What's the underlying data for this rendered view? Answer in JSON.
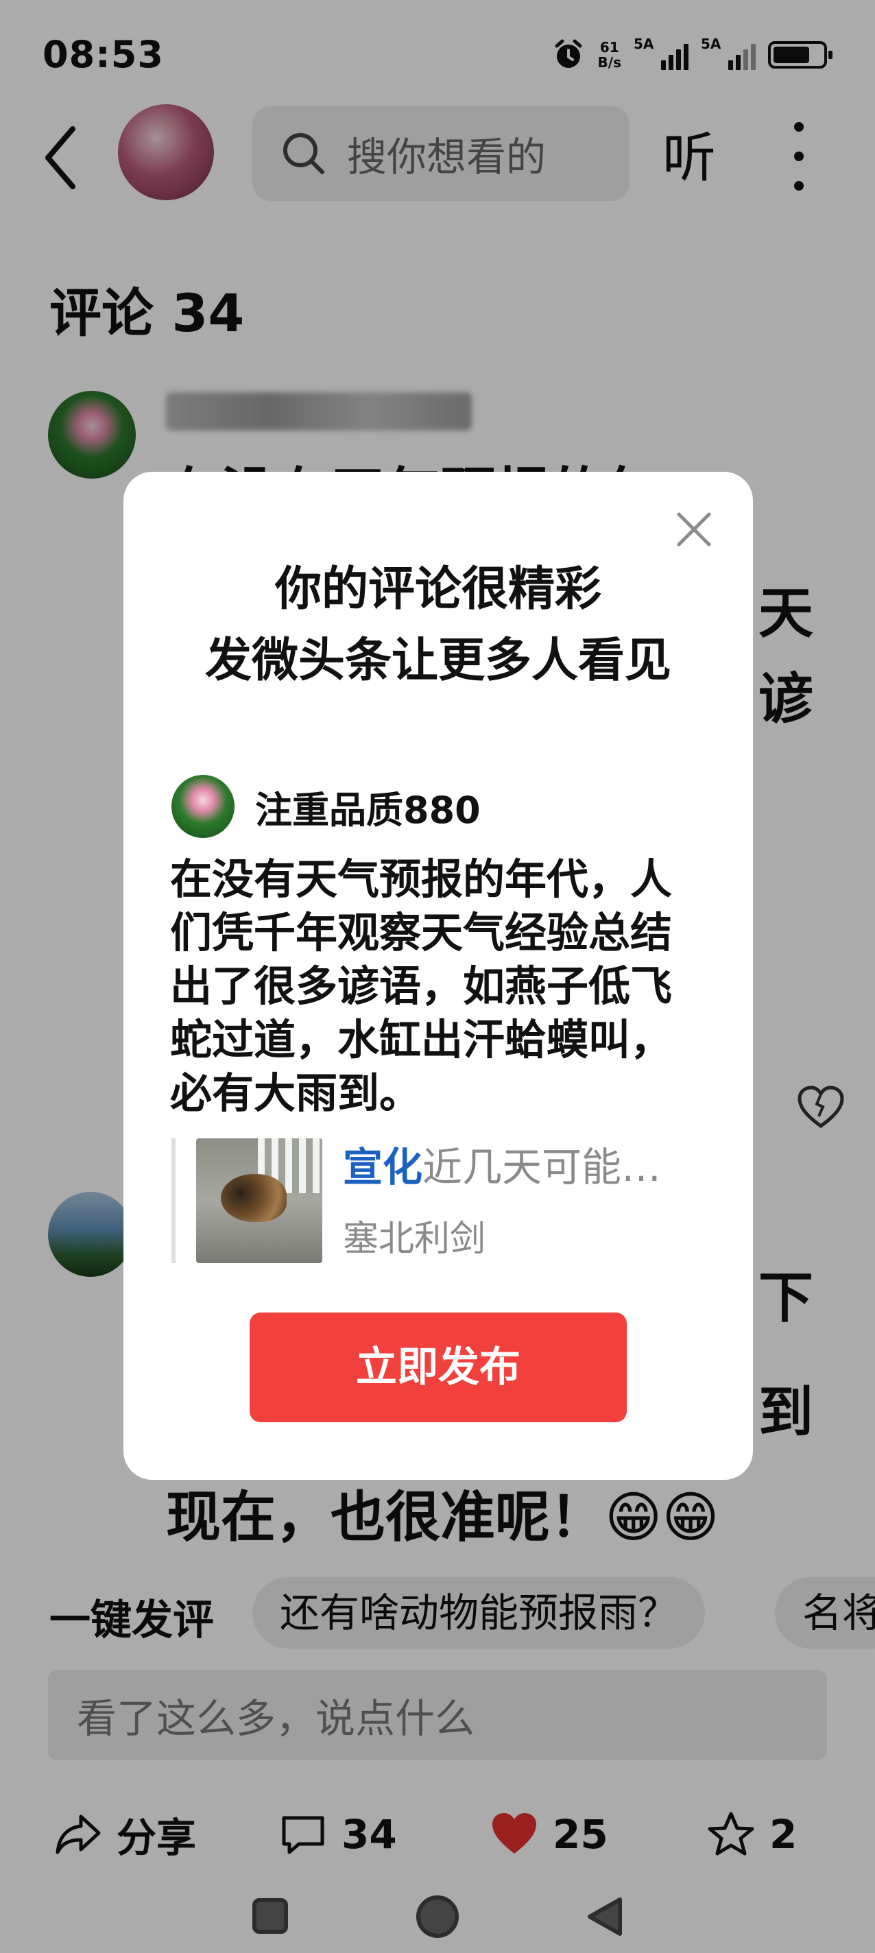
{
  "status_bar": {
    "time": "08:53",
    "net_speed_value": "61",
    "net_speed_unit": "B/s",
    "signal1_label": "5A",
    "signal2_label": "5A"
  },
  "top_nav": {
    "search_placeholder": "搜你想看的",
    "listen_label": "听"
  },
  "comments": {
    "title": "评论 34",
    "first": {
      "line1": "在没有天气预报的年",
      "right_fragment1": "天",
      "right_fragment2": "谚"
    },
    "second": {
      "right_fragment1": "下",
      "right_fragment2": "到",
      "last_line": "现在，也很准呢！😁😁"
    }
  },
  "quick_reply": {
    "label": "一键发评",
    "chips": [
      "还有啥动物能预报雨？",
      "名将"
    ]
  },
  "input": {
    "placeholder": "看了这么多，说点什么"
  },
  "bottom_bar": {
    "share_label": "分享",
    "comment_count": "34",
    "like_count": "25",
    "favorite_count": "2",
    "like_color": "#e5302f"
  },
  "modal": {
    "title_line1": "你的评论很精彩",
    "title_line2": "发微头条让更多人看见",
    "user_name": "注重品质880",
    "body": "在没有天气预报的年代，人们凭千年观察天气经验总结出了很多谚语，如燕子低飞蛇过道，水缸出汗蛤蟆叫，必有大雨到。",
    "quote_highlight": "宣化",
    "quote_title": "近几天可能…",
    "quote_author": "塞北利剑",
    "publish_label": "立即发布",
    "publish_color": "#f2403c"
  }
}
